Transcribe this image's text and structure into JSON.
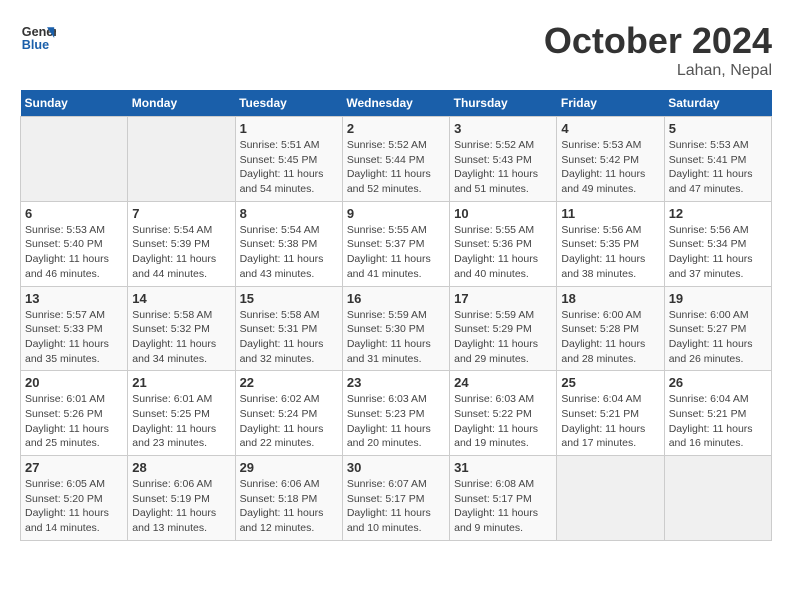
{
  "header": {
    "logo_line1": "General",
    "logo_line2": "Blue",
    "month": "October 2024",
    "location": "Lahan, Nepal"
  },
  "weekdays": [
    "Sunday",
    "Monday",
    "Tuesday",
    "Wednesday",
    "Thursday",
    "Friday",
    "Saturday"
  ],
  "weeks": [
    [
      {
        "day": "",
        "info": ""
      },
      {
        "day": "",
        "info": ""
      },
      {
        "day": "1",
        "info": "Sunrise: 5:51 AM\nSunset: 5:45 PM\nDaylight: 11 hours and 54 minutes."
      },
      {
        "day": "2",
        "info": "Sunrise: 5:52 AM\nSunset: 5:44 PM\nDaylight: 11 hours and 52 minutes."
      },
      {
        "day": "3",
        "info": "Sunrise: 5:52 AM\nSunset: 5:43 PM\nDaylight: 11 hours and 51 minutes."
      },
      {
        "day": "4",
        "info": "Sunrise: 5:53 AM\nSunset: 5:42 PM\nDaylight: 11 hours and 49 minutes."
      },
      {
        "day": "5",
        "info": "Sunrise: 5:53 AM\nSunset: 5:41 PM\nDaylight: 11 hours and 47 minutes."
      }
    ],
    [
      {
        "day": "6",
        "info": "Sunrise: 5:53 AM\nSunset: 5:40 PM\nDaylight: 11 hours and 46 minutes."
      },
      {
        "day": "7",
        "info": "Sunrise: 5:54 AM\nSunset: 5:39 PM\nDaylight: 11 hours and 44 minutes."
      },
      {
        "day": "8",
        "info": "Sunrise: 5:54 AM\nSunset: 5:38 PM\nDaylight: 11 hours and 43 minutes."
      },
      {
        "day": "9",
        "info": "Sunrise: 5:55 AM\nSunset: 5:37 PM\nDaylight: 11 hours and 41 minutes."
      },
      {
        "day": "10",
        "info": "Sunrise: 5:55 AM\nSunset: 5:36 PM\nDaylight: 11 hours and 40 minutes."
      },
      {
        "day": "11",
        "info": "Sunrise: 5:56 AM\nSunset: 5:35 PM\nDaylight: 11 hours and 38 minutes."
      },
      {
        "day": "12",
        "info": "Sunrise: 5:56 AM\nSunset: 5:34 PM\nDaylight: 11 hours and 37 minutes."
      }
    ],
    [
      {
        "day": "13",
        "info": "Sunrise: 5:57 AM\nSunset: 5:33 PM\nDaylight: 11 hours and 35 minutes."
      },
      {
        "day": "14",
        "info": "Sunrise: 5:58 AM\nSunset: 5:32 PM\nDaylight: 11 hours and 34 minutes."
      },
      {
        "day": "15",
        "info": "Sunrise: 5:58 AM\nSunset: 5:31 PM\nDaylight: 11 hours and 32 minutes."
      },
      {
        "day": "16",
        "info": "Sunrise: 5:59 AM\nSunset: 5:30 PM\nDaylight: 11 hours and 31 minutes."
      },
      {
        "day": "17",
        "info": "Sunrise: 5:59 AM\nSunset: 5:29 PM\nDaylight: 11 hours and 29 minutes."
      },
      {
        "day": "18",
        "info": "Sunrise: 6:00 AM\nSunset: 5:28 PM\nDaylight: 11 hours and 28 minutes."
      },
      {
        "day": "19",
        "info": "Sunrise: 6:00 AM\nSunset: 5:27 PM\nDaylight: 11 hours and 26 minutes."
      }
    ],
    [
      {
        "day": "20",
        "info": "Sunrise: 6:01 AM\nSunset: 5:26 PM\nDaylight: 11 hours and 25 minutes."
      },
      {
        "day": "21",
        "info": "Sunrise: 6:01 AM\nSunset: 5:25 PM\nDaylight: 11 hours and 23 minutes."
      },
      {
        "day": "22",
        "info": "Sunrise: 6:02 AM\nSunset: 5:24 PM\nDaylight: 11 hours and 22 minutes."
      },
      {
        "day": "23",
        "info": "Sunrise: 6:03 AM\nSunset: 5:23 PM\nDaylight: 11 hours and 20 minutes."
      },
      {
        "day": "24",
        "info": "Sunrise: 6:03 AM\nSunset: 5:22 PM\nDaylight: 11 hours and 19 minutes."
      },
      {
        "day": "25",
        "info": "Sunrise: 6:04 AM\nSunset: 5:21 PM\nDaylight: 11 hours and 17 minutes."
      },
      {
        "day": "26",
        "info": "Sunrise: 6:04 AM\nSunset: 5:21 PM\nDaylight: 11 hours and 16 minutes."
      }
    ],
    [
      {
        "day": "27",
        "info": "Sunrise: 6:05 AM\nSunset: 5:20 PM\nDaylight: 11 hours and 14 minutes."
      },
      {
        "day": "28",
        "info": "Sunrise: 6:06 AM\nSunset: 5:19 PM\nDaylight: 11 hours and 13 minutes."
      },
      {
        "day": "29",
        "info": "Sunrise: 6:06 AM\nSunset: 5:18 PM\nDaylight: 11 hours and 12 minutes."
      },
      {
        "day": "30",
        "info": "Sunrise: 6:07 AM\nSunset: 5:17 PM\nDaylight: 11 hours and 10 minutes."
      },
      {
        "day": "31",
        "info": "Sunrise: 6:08 AM\nSunset: 5:17 PM\nDaylight: 11 hours and 9 minutes."
      },
      {
        "day": "",
        "info": ""
      },
      {
        "day": "",
        "info": ""
      }
    ]
  ]
}
